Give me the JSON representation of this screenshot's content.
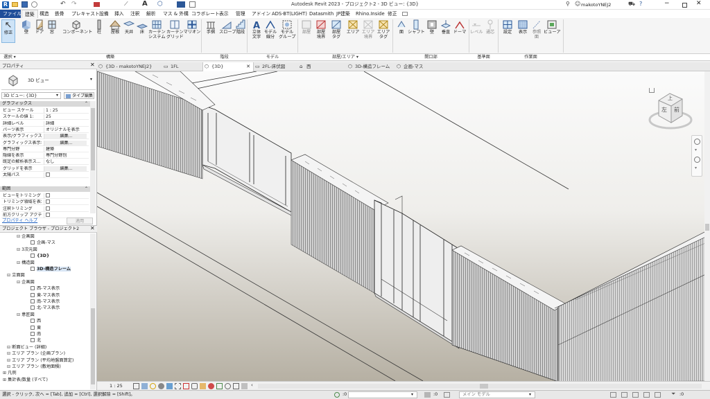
{
  "title_bar": {
    "title": "Autodesk Revit 2023 - プロジェクト2 - 3D ビュー: {3D}",
    "user": "makotoYNEJ2"
  },
  "menu_tabs": [
    "ファイル",
    "建築",
    "構造",
    "鉄骨",
    "プレキャスト",
    "設備",
    "挿入",
    "注釈",
    "解析",
    "マス & 外構",
    "コラボレート",
    "表示",
    "管理",
    "アドイン",
    "ADS-BT(LIGHT)",
    "Datasmith",
    "JP建築",
    "Rhino.Inside",
    "修正"
  ],
  "ribbon": {
    "buttons": {
      "modify": "修正",
      "wall": "壁",
      "door": "ドア",
      "window": "窓",
      "component": "コンポーネント",
      "column": "柱",
      "roof": "屋根",
      "ceiling": "天井",
      "floor": "床",
      "curtain_system": "カーテン\nシステム",
      "curtain_grid": "カーテン\nグリッド",
      "mullion": "マリオン",
      "railing": "手摺",
      "ramp": "スロープ",
      "stair": "階段",
      "model_text": "立体\n文字",
      "model_line": "モデル\n線分",
      "model_group": "モデル\nグループ",
      "room": "部屋",
      "room_separator": "部屋\n境界",
      "room_tag": "部屋\nタグ",
      "area": "エリア",
      "area_boundary": "エリア\n境界",
      "area_tag": "エリア\nタグ",
      "by_face": "面",
      "shaft": "シャフト",
      "opening_wall": "壁",
      "vertical": "垂直",
      "dormer": "ドーマ",
      "level": "レベル",
      "grid": "通芯",
      "set": "設定",
      "show": "表示",
      "ref_plane": "参照\n面",
      "viewer": "ビューア"
    },
    "groups": {
      "select": "選択 ▾",
      "build": "構築",
      "circulation": "階段",
      "model": "モデル",
      "room_area": "部屋/エリア ▾",
      "opening": "開口部",
      "datum": "基準面",
      "work_plane": "作業面"
    }
  },
  "properties": {
    "panel_title": "プロパティ",
    "type_name": "3D ビュー",
    "view_selector": "3D ビュー: {3D}",
    "type_edit": "タイプ編集",
    "section_graphics": "グラフィックス",
    "rows": [
      {
        "key": "ビュー スケール",
        "value": "1 : 25"
      },
      {
        "key": "スケールの値 1:",
        "value": "25"
      },
      {
        "key": "詳細レベル",
        "value": "詳細"
      },
      {
        "key": "パーツ表示",
        "value": "オリジナルを表示"
      },
      {
        "key": "表示/グラフィックス...",
        "value": "編集..."
      },
      {
        "key": "グラフィックス表示オ...",
        "value": "編集..."
      },
      {
        "key": "専門分野",
        "value": "建築"
      },
      {
        "key": "隠線を表示",
        "value": "専門分野別"
      },
      {
        "key": "既定の解析表示ス...",
        "value": "なし"
      },
      {
        "key": "グリッドを表示",
        "value": "編集..."
      },
      {
        "key": "太陽パス",
        "value": ""
      }
    ],
    "section_extents": "範囲",
    "rows2": [
      {
        "key": "ビューをトリミング",
        "value": ""
      },
      {
        "key": "トリミング領域を表示",
        "value": ""
      },
      {
        "key": "注釈トリミング",
        "value": ""
      },
      {
        "key": "前方クリップ アクティブ",
        "value": ""
      }
    ],
    "help_link": "プロパティ ヘルプ",
    "apply": "適用"
  },
  "browser": {
    "title": "プロジェクト ブラウザ - プロジェクト2",
    "items": [
      {
        "label": "企画図",
        "level": 1
      },
      {
        "label": "企画-マス",
        "level": 2
      },
      {
        "label": "3次元図",
        "level": 1
      },
      {
        "label": "{3D}",
        "level": 2
      },
      {
        "label": "構造図",
        "level": 1
      },
      {
        "label": "3D-構造フレーム",
        "level": 2
      },
      {
        "label": "立面図",
        "level": 0
      },
      {
        "label": "企画図",
        "level": 1
      },
      {
        "label": "西-マス表示",
        "level": 2
      },
      {
        "label": "東-マス表示",
        "level": 2
      },
      {
        "label": "南-マス表示",
        "level": 2
      },
      {
        "label": "北-マス表示",
        "level": 2
      },
      {
        "label": "意匠図",
        "level": 1
      },
      {
        "label": "西",
        "level": 2
      },
      {
        "label": "東",
        "level": 2
      },
      {
        "label": "南",
        "level": 2
      },
      {
        "label": "北",
        "level": 2
      },
      {
        "label": "断面ビュー (詳細)",
        "level": 0
      },
      {
        "label": "エリア プラン (企画プラン)",
        "level": 0
      },
      {
        "label": "エリア プラン (平均地盤面算定)",
        "level": 0
      },
      {
        "label": "エリア プラン (敷地面積)",
        "level": 0
      },
      {
        "label": "凡例",
        "level": -1
      },
      {
        "label": "集計表/数量 (すべて)",
        "level": -1
      }
    ]
  },
  "view_tabs": [
    {
      "label": "{3D - makotoYNEJ2}",
      "active": false
    },
    {
      "label": "1FL",
      "active": false
    },
    {
      "label": "{3D}",
      "active": true
    },
    {
      "label": "2FL-床伏図",
      "active": false
    },
    {
      "label": "西",
      "active": false
    },
    {
      "label": "3D-構造フレーム",
      "active": false
    },
    {
      "label": "企画-マス",
      "active": false
    }
  ],
  "viewcube": {
    "top": "上",
    "left": "左",
    "front": "前"
  },
  "view_bar": {
    "scale": "1 : 25"
  },
  "status_bar": {
    "hint": "選択 - クリック, 次へ = [Tab], 追加 = [Ctrl], 選択解除 = [Shift]。",
    "zero": ":0",
    "model": "メイン モデル"
  },
  "colors": {
    "accent_blue": "#2b5797",
    "file_tab": "#1f4e99",
    "wall_grey": "#c4c4c4",
    "background_top": "#fbfbfb",
    "background_bottom": "#b6b0a3"
  }
}
